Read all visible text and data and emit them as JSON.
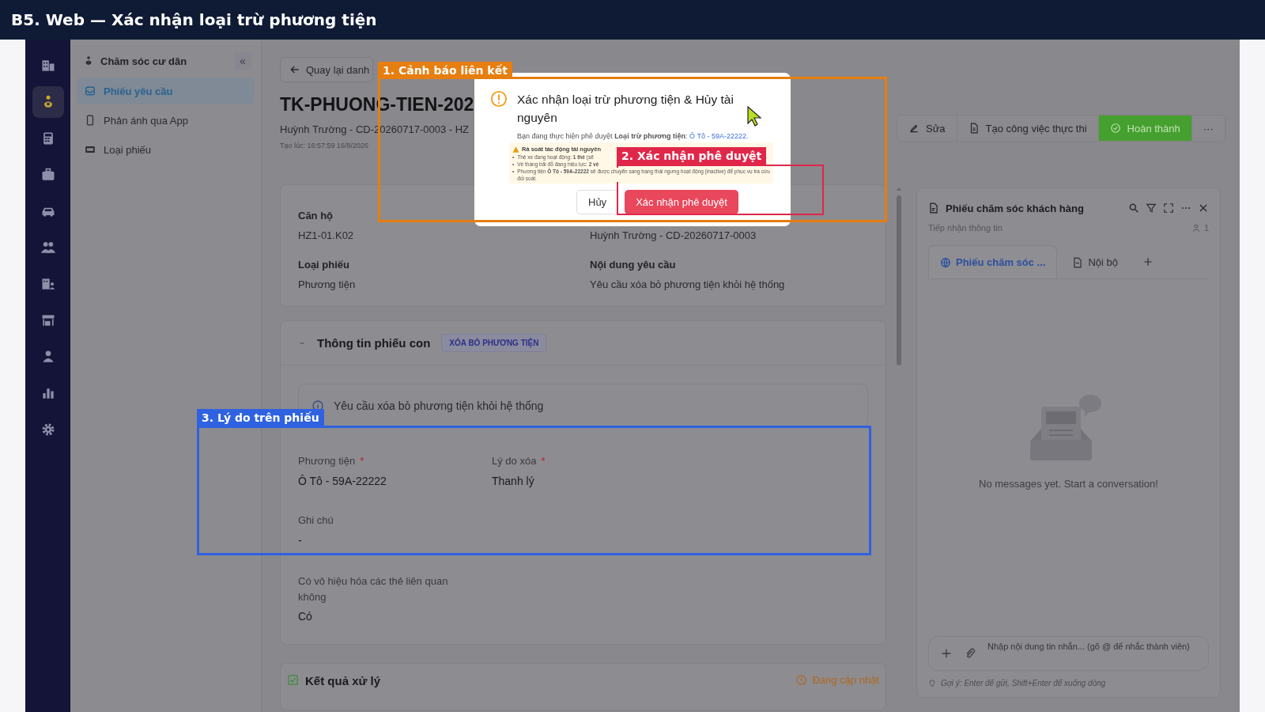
{
  "title_bar": {
    "title": "B5. Web — Xác nhận loại trừ phương tiện"
  },
  "rail": [
    {
      "kind": "building",
      "selected": false
    },
    {
      "kind": "care",
      "selected": true
    },
    {
      "kind": "calculator",
      "selected": false
    },
    {
      "kind": "briefcase",
      "selected": false
    },
    {
      "kind": "car",
      "selected": false
    },
    {
      "kind": "people",
      "selected": false
    },
    {
      "kind": "office",
      "selected": false
    },
    {
      "kind": "store",
      "selected": false
    },
    {
      "kind": "person",
      "selected": false
    },
    {
      "kind": "chart",
      "selected": false
    },
    {
      "kind": "settings",
      "selected": false
    }
  ],
  "sidebar": {
    "title": "Chăm sóc cư dân",
    "collapse": "«",
    "items": [
      {
        "label": "Phiếu yêu cầu",
        "kind": "inbox",
        "selected": true
      },
      {
        "label": "Phản ánh qua App",
        "kind": "phone",
        "selected": false
      },
      {
        "label": "Loại phiếu",
        "kind": "card",
        "selected": false
      }
    ]
  },
  "header": {
    "back": "Quay lại danh",
    "title": "TK-PHUONG-TIEN-202",
    "subtitle": "Huỳnh Trường - CD-20260717-0003 - HZ",
    "created": "Tạo lúc: 16:57:59 16/8/2026"
  },
  "actions": [
    {
      "label": "Sửa",
      "kind": "edit"
    },
    {
      "label": "Tạo công việc thực thi",
      "kind": "task"
    },
    {
      "label": "Hoàn thành",
      "kind": "primary"
    },
    {
      "label": "···",
      "kind": "more"
    }
  ],
  "summary_card": {
    "fields": [
      {
        "label": "Căn hộ",
        "value": "HZ1-01.K02"
      },
      {
        "value": "Huỳnh Trường - CD-20260717-0003"
      },
      {
        "label": "Loại phiếu",
        "value": "Phương tiện"
      },
      {
        "label": "Nội dung yêu cầu",
        "value": "Yêu cầu xóa bỏ phương tiện khỏi hệ thống"
      }
    ]
  },
  "child_ticket": {
    "title": "Thông tin phiếu con",
    "tag": "XÓA BỎ PHƯƠNG TIỆN",
    "info": "Yêu cầu xóa bỏ phương tiện khỏi hệ thống",
    "fields": [
      {
        "label": "Phương tiện",
        "mark": "*",
        "value": "Ô Tô - 59A-22222"
      },
      {
        "label": "Lý do xóa",
        "mark": "*",
        "value": "Thanh lý"
      },
      {
        "label": "Ghi chú",
        "value": "-"
      },
      {
        "label": "Có vô hiệu hóa các thẻ liên quan không",
        "value": "Có"
      }
    ]
  },
  "result": {
    "title": "Kết quả xử lý",
    "status": "Đang cập nhật"
  },
  "chat": {
    "title": "Phiếu chăm sóc khách hàng",
    "stage": "Tiếp nhận thông tin",
    "members": "1",
    "tabs": [
      {
        "label": "Phiếu chăm sóc ...",
        "selected": true
      },
      {
        "label": "Nội bộ",
        "selected": false
      }
    ],
    "empty": "No messages yet. Start a conversation!",
    "input": {
      "placeholder": "Nhập nội dung tin nhắn... (gõ @ để nhắc thành viên)"
    },
    "hint": "Gợi ý: Enter để gửi, Shift+Enter để xuống dòng"
  },
  "dialog": {
    "title": "Xác nhận loại trừ phương tiện & Hủy tài nguyên",
    "message": "Bạn đang thực hiện phê duyệt **Loại trừ phương tiện**: ",
    "link": "Ô Tô - 59A-22222.",
    "warning": {
      "title": "Rà soát tác động tài nguyên",
      "bullet": "•",
      "items": [
        "Thẻ xe đang hoạt động: **1 thẻ** (sẽ",
        "Vé tháng bãi đỗ đang hiệu lực: **2 vé**",
        "Phương tiện **Ô Tô - 59A-22222** sẽ được chuyển sang trạng thái ngưng hoạt động (inactive) để phục vụ tra cứu đối soát."
      ]
    },
    "buttons": [
      {
        "label": "Hủy",
        "kind": "secondary"
      },
      {
        "label": "Xác nhận phê duyệt",
        "kind": "primary"
      }
    ]
  },
  "annotations": [
    {
      "label": "1. Cảnh báo liên kết",
      "color": "#e67e10"
    },
    {
      "label": "2. Xác nhận phê duyệt",
      "color": "#e0274a"
    },
    {
      "label": "3. Lý do trên phiếu",
      "color": "#2f62e0"
    }
  ]
}
